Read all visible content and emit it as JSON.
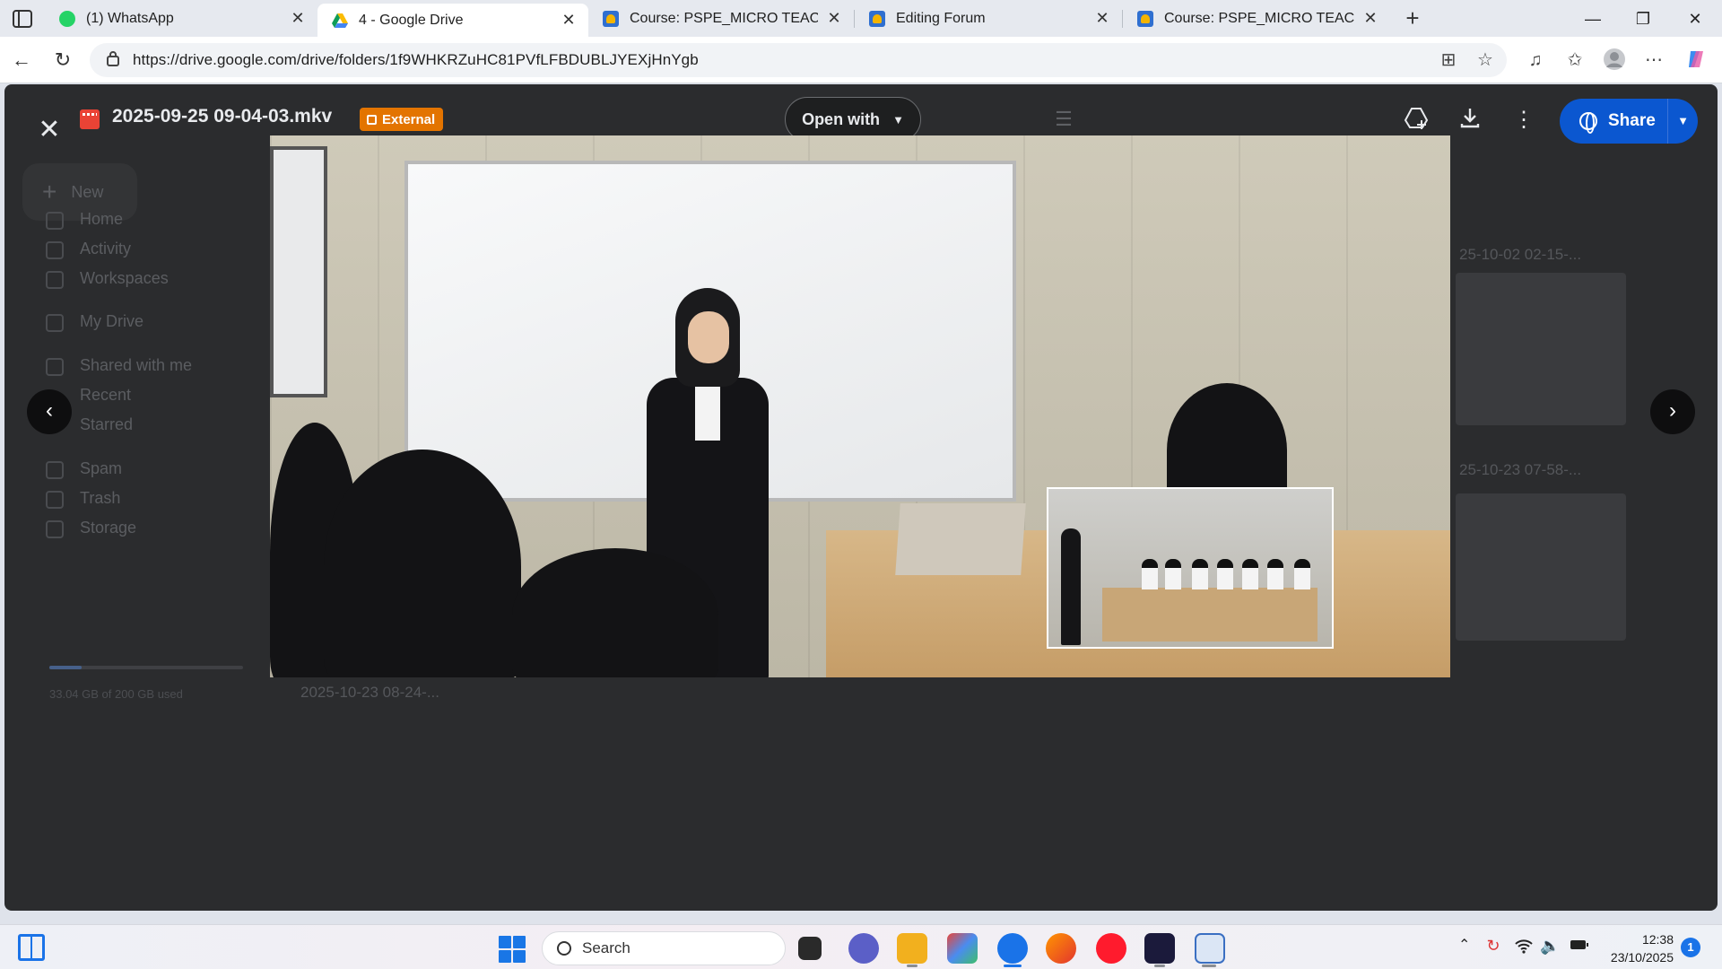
{
  "browser": {
    "tabs": [
      {
        "label": "(1) WhatsApp",
        "active": false
      },
      {
        "label": "4 - Google Drive",
        "active": true
      },
      {
        "label": "Course: PSPE_MICRO TEACHING_",
        "active": false
      },
      {
        "label": "Editing Forum",
        "active": false
      },
      {
        "label": "Course: PSPE_MICRO TEACHING I",
        "active": false
      }
    ],
    "url": "https://drive.google.com/drive/folders/1f9WHKRZuHC81PVfLFBDUBLJYEXjHnYgb"
  },
  "viewer": {
    "file_name": "2025-09-25 09-04-03.mkv",
    "badge": "External",
    "open_with_label": "Open with",
    "share_label": "Share"
  },
  "drive_background": {
    "new_label": "New",
    "nav": [
      "Home",
      "Activity",
      "Workspaces",
      "My Drive",
      "Shared with me",
      "Recent",
      "Starred",
      "Spam",
      "Trash",
      "Storage"
    ],
    "storage_text": "33.04 GB of 200 GB used",
    "storage_fraction": 0.165,
    "files": [
      "25-10-02 02-15-...",
      "25-10-23 07-58-...",
      "2025-10-23 08-24-..."
    ]
  },
  "taskbar": {
    "search_label": "Search",
    "time": "12:38",
    "date": "23/10/2025",
    "notification_count": "1"
  },
  "colors": {
    "share_blue": "#0b57d0",
    "external_badge": "#e37400",
    "viewer_bg": "#2b2c2e"
  }
}
